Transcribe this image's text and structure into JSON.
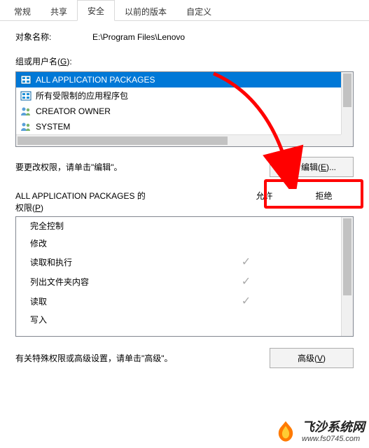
{
  "tabs": {
    "items": [
      {
        "label": "常规"
      },
      {
        "label": "共享"
      },
      {
        "label": "安全"
      },
      {
        "label": "以前的版本"
      },
      {
        "label": "自定义"
      }
    ],
    "active_index": 2
  },
  "object": {
    "label": "对象名称:",
    "value": "E:\\Program Files\\Lenovo"
  },
  "groups": {
    "label_prefix": "组或用户名(",
    "label_key": "G",
    "label_suffix": "):",
    "items": [
      {
        "name": "ALL APPLICATION PACKAGES",
        "icon": "metro-group",
        "selected": true
      },
      {
        "name": "所有受限制的应用程序包",
        "icon": "metro-group",
        "selected": false
      },
      {
        "name": "CREATOR OWNER",
        "icon": "users",
        "selected": false
      },
      {
        "name": "SYSTEM",
        "icon": "users",
        "selected": false
      }
    ]
  },
  "edit": {
    "hint": "要更改权限，请单击\"编辑\"。",
    "button_prefix": "编辑(",
    "button_key": "E",
    "button_suffix": ")..."
  },
  "permissions": {
    "title_line1": "ALL APPLICATION PACKAGES 的",
    "title_line2_prefix": "权限(",
    "title_line2_key": "P",
    "title_line2_suffix": ")",
    "col_allow": "允许",
    "col_deny": "拒绝",
    "rows": [
      {
        "name": "完全控制",
        "allow": false,
        "deny": false
      },
      {
        "name": "修改",
        "allow": false,
        "deny": false
      },
      {
        "name": "读取和执行",
        "allow": true,
        "deny": false
      },
      {
        "name": "列出文件夹内容",
        "allow": true,
        "deny": false
      },
      {
        "name": "读取",
        "allow": true,
        "deny": false
      },
      {
        "name": "写入",
        "allow": false,
        "deny": false
      }
    ]
  },
  "advanced": {
    "hint": "有关特殊权限或高级设置，请单击\"高级\"。",
    "button_prefix": "高级(",
    "button_key": "V",
    "button_suffix": ")"
  },
  "watermark": {
    "line1": "飞沙系统网",
    "line2": "www.fs0745.com"
  }
}
